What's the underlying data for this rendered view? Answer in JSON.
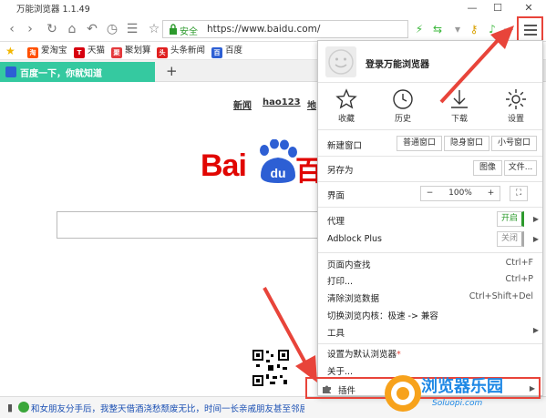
{
  "window": {
    "title": "万能浏览器 1.1.49"
  },
  "nav": {
    "secure_label": "安全",
    "url": "https://www.baidu.com/"
  },
  "bookmarks": [
    {
      "label": "爱淘宝",
      "icon": "taobao-icon",
      "color": "#ff5000"
    },
    {
      "label": "天猫",
      "icon": "tmall-icon",
      "color": "#d7000f"
    },
    {
      "label": "聚划算",
      "icon": "juhuasuan-icon",
      "color": "#e4393c"
    },
    {
      "label": "头条新闻",
      "icon": "toutiao-icon",
      "color": "#e02020"
    },
    {
      "label": "百度",
      "icon": "baidu-icon",
      "color": "#2d5fd4"
    }
  ],
  "tab": {
    "title": "百度一下，你就知道"
  },
  "page": {
    "links": [
      "新闻",
      "hao123",
      "地"
    ],
    "logo_text_left": "Bai",
    "logo_text_paw": "du",
    "logo_text_right": "百"
  },
  "statusbar": {
    "news": "和女朋友分手后，我整天借酒浇愁颓废无比，时间一长亲戚朋友甚至邻居们都看不下去了"
  },
  "menu": {
    "login": "登录万能浏览器",
    "icons": [
      {
        "label": "收藏",
        "icon": "star-icon"
      },
      {
        "label": "历史",
        "icon": "clock-icon"
      },
      {
        "label": "下载",
        "icon": "download-icon"
      },
      {
        "label": "设置",
        "icon": "gear-icon"
      }
    ],
    "new_window": {
      "label": "新建窗口",
      "options": [
        "普通窗口",
        "隐身窗口",
        "小号窗口"
      ]
    },
    "save_as": {
      "label": "另存为",
      "options": [
        "图像",
        "文件..."
      ]
    },
    "interface": {
      "label": "界面",
      "minus": "−",
      "zoom": "100%",
      "plus": "+"
    },
    "proxy": {
      "label": "代理",
      "state": "开启"
    },
    "adblock": {
      "label": "Adblock Plus",
      "state": "关闭"
    },
    "find": {
      "label": "页面内查找",
      "shortcut": "Ctrl+F"
    },
    "print": {
      "label": "打印...",
      "shortcut": "Ctrl+P"
    },
    "clear": {
      "label": "清除浏览数据",
      "shortcut": "Ctrl+Shift+Del"
    },
    "switch_core": {
      "label": "切换浏览内核：极速 -> 兼容"
    },
    "tools": {
      "label": "工具"
    },
    "default": {
      "label": "设置为默认浏览器",
      "mark": "*"
    },
    "about": {
      "label": "关于..."
    },
    "plugins": {
      "label": "插件"
    }
  },
  "watermark": {
    "title": "浏览器乐园",
    "domain": "Soluopi.com"
  },
  "colors": {
    "accent_red": "#e8443a",
    "tab_green": "#35c9a0",
    "baidu_red": "#e10602",
    "baidu_blue": "#2d5fd4"
  }
}
